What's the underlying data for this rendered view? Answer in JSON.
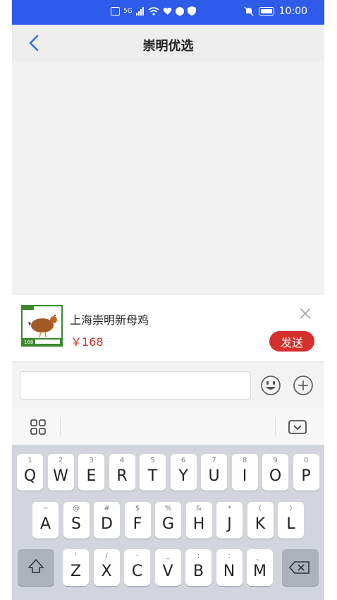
{
  "status_bar": {
    "time": "10:00",
    "network": "5G",
    "icons": [
      "hd-icon",
      "signal-icon",
      "wifi-icon",
      "heart-icon",
      "app-icon",
      "shield-icon",
      "mute-bell-icon",
      "battery-icon"
    ],
    "background": "#2f5bea"
  },
  "header": {
    "title": "崇明优选",
    "back_icon": "chevron-left-icon"
  },
  "product": {
    "title": "上海崇明新母鸡",
    "price": "￥168",
    "thumbnail_badge_price": "168",
    "send_label": "发送",
    "accent": "#d4302c"
  },
  "input": {
    "placeholder": "",
    "value": ""
  },
  "keyboard": {
    "toolbar_icons": [
      "grid-icon",
      "keyboard-hide-icon"
    ],
    "row1": [
      {
        "main": "Q",
        "sub": "1"
      },
      {
        "main": "W",
        "sub": "2"
      },
      {
        "main": "E",
        "sub": "3"
      },
      {
        "main": "R",
        "sub": "4"
      },
      {
        "main": "T",
        "sub": "5"
      },
      {
        "main": "Y",
        "sub": "6"
      },
      {
        "main": "U",
        "sub": "7"
      },
      {
        "main": "I",
        "sub": "8"
      },
      {
        "main": "O",
        "sub": "9"
      },
      {
        "main": "P",
        "sub": "0"
      }
    ],
    "row2": [
      {
        "main": "A",
        "sub": "~"
      },
      {
        "main": "S",
        "sub": "@"
      },
      {
        "main": "D",
        "sub": "#"
      },
      {
        "main": "F",
        "sub": "$"
      },
      {
        "main": "G",
        "sub": "%"
      },
      {
        "main": "H",
        "sub": "&"
      },
      {
        "main": "J",
        "sub": "*"
      },
      {
        "main": "K",
        "sub": "("
      },
      {
        "main": "L",
        "sub": ")"
      }
    ],
    "row3": [
      {
        "main": "Z",
        "sub": "'"
      },
      {
        "main": "X",
        "sub": "/"
      },
      {
        "main": "C",
        "sub": "-"
      },
      {
        "main": "V",
        "sub": "_"
      },
      {
        "main": "B",
        "sub": ":"
      },
      {
        "main": "N",
        "sub": ";"
      },
      {
        "main": "M",
        "sub": "、"
      }
    ]
  }
}
